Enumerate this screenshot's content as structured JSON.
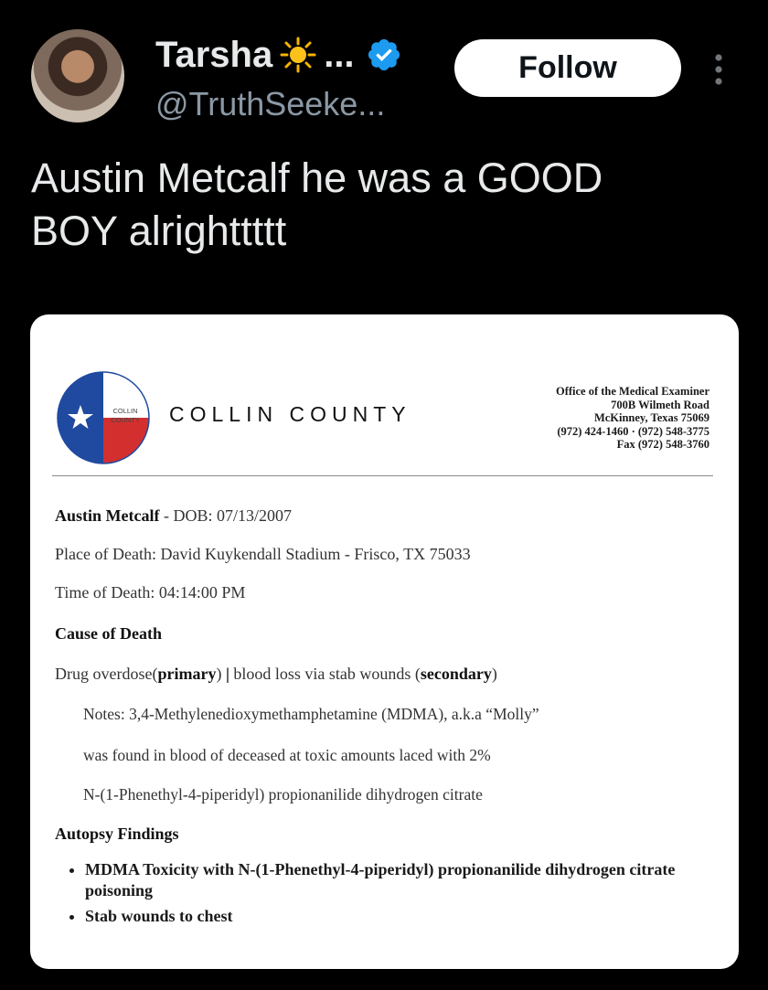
{
  "author": {
    "name": "Tarsha",
    "name_suffix": "...",
    "handle": "@TruthSeeke...",
    "verified_color": "#1d9bf0"
  },
  "follow_label": "Follow",
  "tweet_text_line1": "Austin Metcalf he was a GOOD",
  "tweet_text_line2": "BOY alrighttttt",
  "document": {
    "seal_text_1": "COLLIN",
    "seal_text_2": "COUNTY",
    "county_name": "COLLIN COUNTY",
    "office": [
      "Office of the Medical Examiner",
      "700B Wilmeth Road",
      "McKinney, Texas  75069",
      "(972) 424-1460 · (972) 548-3775",
      "Fax (972) 548-3760"
    ],
    "name_label": "Austin Metcalf",
    "dob": " - DOB: 07/13/2007",
    "place_of_death": "Place of Death: David Kuykendall Stadium - Frisco, TX 75033",
    "time_of_death": "Time of Death: 04:14:00 PM",
    "cause_heading": "Cause of Death",
    "cause_part1": "Drug overdose(",
    "cause_primary": "primary",
    "cause_part2": ") ",
    "cause_sep": "|",
    "cause_part3": " blood loss via stab wounds (",
    "cause_secondary": "secondary",
    "cause_part4": ")",
    "notes": [
      "Notes: 3,4-Methylenedioxymethamphetamine (MDMA), a.k.a “Molly”",
      "was found in blood of deceased at toxic amounts laced with 2%",
      "N-(1-Phenethyl-4-piperidyl) propionanilide dihydrogen citrate"
    ],
    "autopsy_heading": "Autopsy Findings",
    "findings": [
      "MDMA Toxicity with N-(1-Phenethyl-4-piperidyl) propionanilide dihydrogen citrate poisoning",
      "Stab wounds to chest"
    ]
  }
}
